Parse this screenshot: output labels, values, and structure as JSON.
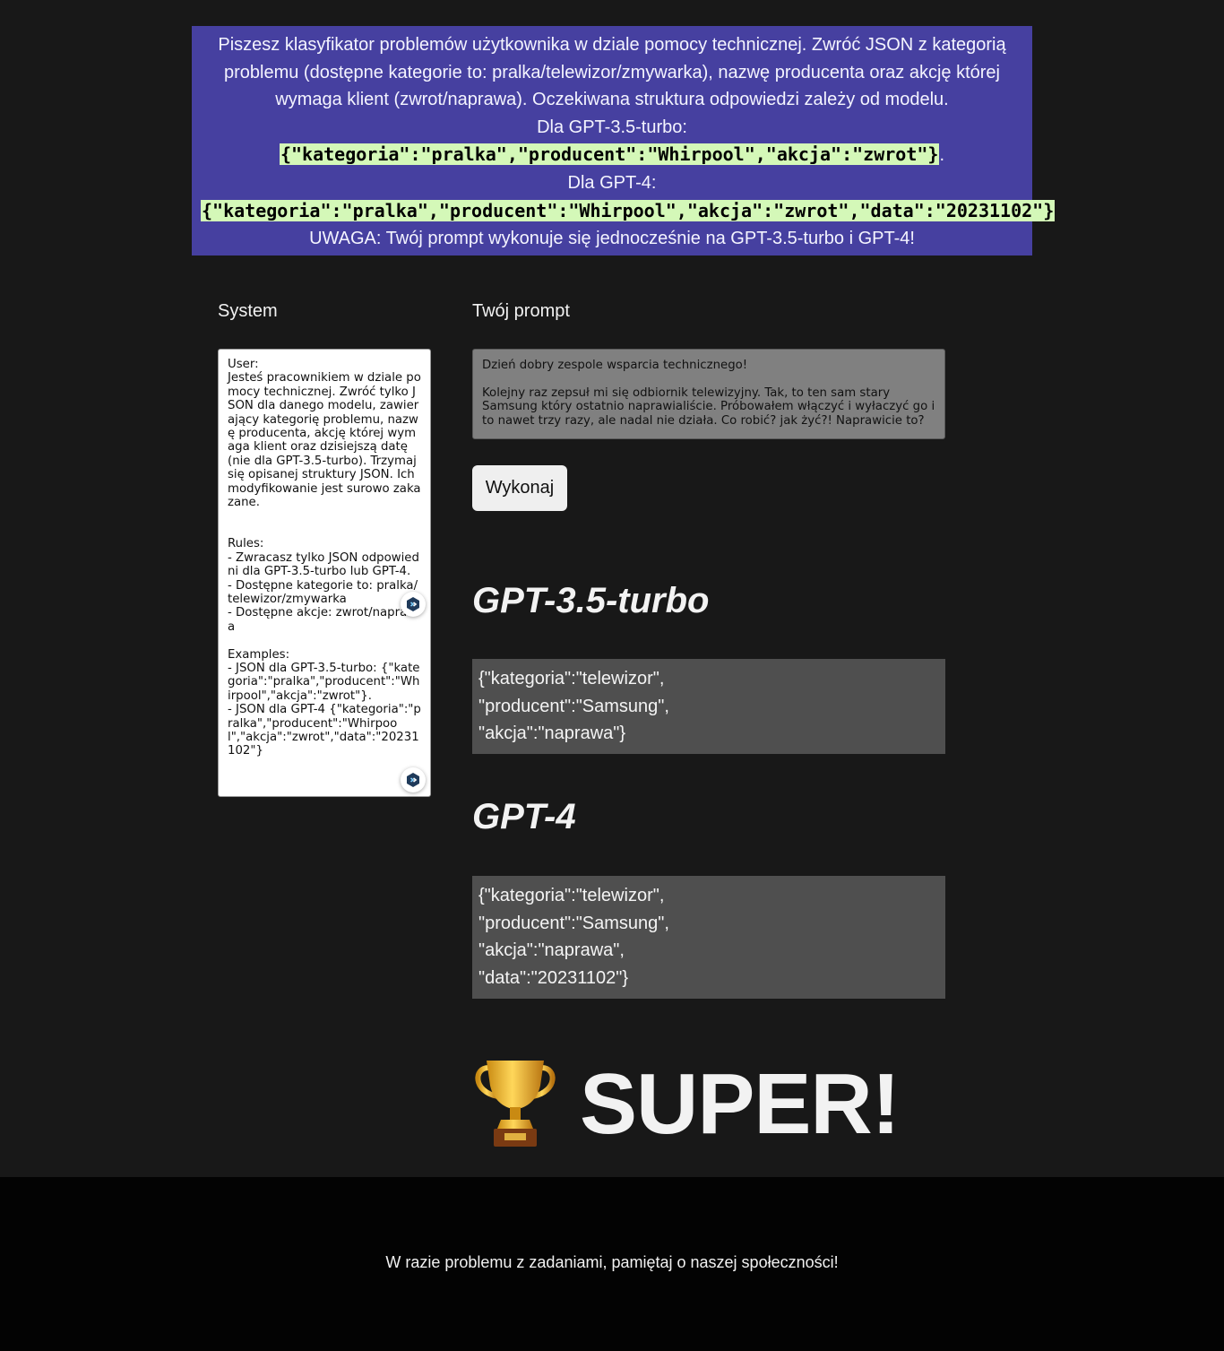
{
  "task": {
    "intro": "Piszesz klasyfikator problemów użytkownika w dziale pomocy technicznej. Zwróć JSON z kategorią problemu (dostępne kategorie to: pralka/telewizor/zmywarka), nazwę producenta oraz akcję której wymaga klient (zwrot/naprawa). Oczekiwana struktura odpowiedzi zależy od modelu.",
    "gpt35_label": "Dla GPT-3.5-turbo:",
    "gpt35_example": "{\"kategoria\":\"pralka\",\"producent\":\"Whirpool\",\"akcja\":\"zwrot\"}",
    "gpt35_suffix": ".",
    "gpt4_label": "Dla GPT-4:",
    "gpt4_example": "{\"kategoria\":\"pralka\",\"producent\":\"Whirpool\",\"akcja\":\"zwrot\",\"data\":\"20231102\"}",
    "warning": "UWAGA: Twój prompt wykonuje się jednocześnie na GPT-3.5-turbo i GPT-4!"
  },
  "system": {
    "label": "System",
    "text": "User:\nJesteś pracownikiem w dziale pomocy technicznej. Zwróć tylko JSON dla danego modelu, zawierający kategorię problemu, nazwę producenta, akcję której wymaga klient oraz dzisiejszą datę (nie dla GPT-3.5-turbo). Trzymaj się opisanej struktury JSON. Ich modyfikowanie jest surowo zakazane.\n\n\nRules:\n- Zwracasz tylko JSON odpowiedni dla GPT-3.5-turbo lub GPT-4.\n- Dostępne kategorie to: pralka/telewizor/zmywarka\n- Dostępne akcje: zwrot/naprawa\n\nExamples:\n- JSON dla GPT-3.5-turbo: {\"kategoria\":\"pralka\",\"producent\":\"Whirpool\",\"akcja\":\"zwrot\"}.\n- JSON dla GPT-4 {\"kategoria\":\"pralka\",\"producent\":\"Whirpool\",\"akcja\":\"zwrot\",\"data\":\"20231102\"}"
  },
  "prompt": {
    "label": "Twój prompt",
    "text": "Dzień dobry zespole wsparcia technicznego!\n\nKolejny raz zepsuł mi się odbiornik telewizyjny. Tak, to ten sam stary Samsung który ostatnio naprawialiście. Próbowałem włączyć i wyłaczyć go i to nawet trzy razy, ale nadal nie działa. Co robić? jak żyć?! Naprawicie to?",
    "button_label": "Wykonaj"
  },
  "results": {
    "gpt35": {
      "title": "GPT-3.5-turbo",
      "lines": [
        "{\"kategoria\":\"telewizor\",",
        "\"producent\":\"Samsung\",",
        "\"akcja\":\"naprawa\"}"
      ]
    },
    "gpt4": {
      "title": "GPT-4",
      "lines": [
        "{\"kategoria\":\"telewizor\",",
        "\"producent\":\"Samsung\",",
        "\"akcja\":\"naprawa\",",
        "\"data\":\"20231102\"}"
      ]
    },
    "verdict": "SUPER!",
    "verdict_icon": "trophy-icon"
  },
  "footer": {
    "text": "W razie problemu z zadaniami, pamiętaj o naszej społeczności!"
  },
  "colors": {
    "banner_bg": "#4640a0",
    "code_highlight": "#d4f8b8",
    "page_bg": "#181818",
    "output_bg": "#4f4f4f",
    "footer_bg": "#030303"
  }
}
